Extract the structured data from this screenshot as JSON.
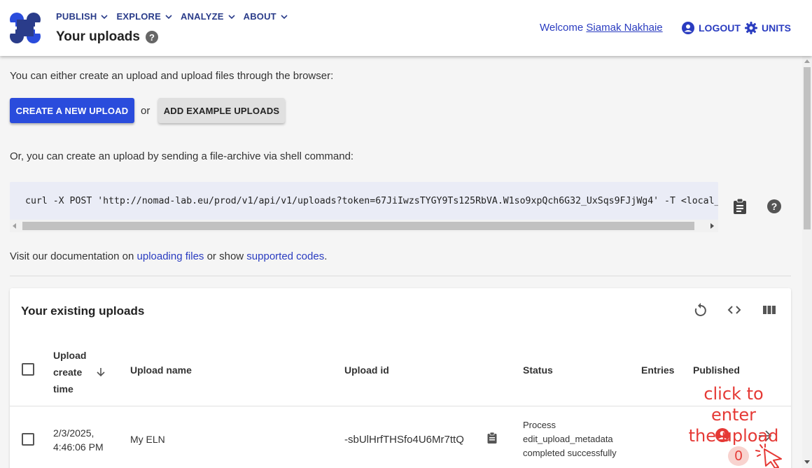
{
  "header": {
    "nav": [
      {
        "label": "PUBLISH"
      },
      {
        "label": "EXPLORE"
      },
      {
        "label": "ANALYZE"
      },
      {
        "label": "ABOUT"
      }
    ],
    "title": "Your uploads",
    "welcome_prefix": "Welcome",
    "user_name": "Siamak Nakhaie",
    "logout_label": "LOGOUT",
    "units_label": "UNITS"
  },
  "main": {
    "intro_text": "You can either create an upload and upload files through the browser:",
    "create_button": "CREATE A NEW UPLOAD",
    "or_text": "or",
    "example_button": "ADD EXAMPLE UPLOADS",
    "shell_text": "Or, you can create an upload by sending a file-archive via shell command:",
    "curl_command": "curl -X POST 'http://nomad-lab.eu/prod/v1/api/v1/uploads?token=67JiIwzsTYGY9Ts125RbVA.W1so9xpQch6G32_UxSqs9FJjWg4' -T <local_file>",
    "docs_prefix": "Visit our documentation on",
    "docs_link_1": "uploading files",
    "docs_middle": "or show",
    "docs_link_2": "supported codes",
    "docs_suffix": "."
  },
  "uploads": {
    "title": "Your existing uploads",
    "columns": {
      "create_time_1": "Upload",
      "create_time_2": "create",
      "create_time_3": "time",
      "name": "Upload name",
      "id": "Upload id",
      "status": "Status",
      "entries": "Entries",
      "published": "Published"
    },
    "rows": [
      {
        "date": "2/3/2025,",
        "time": "4:46:06 PM",
        "name": "My ELN",
        "id": "-sbUlHrfTHSfo4U6Mr7ttQ",
        "status_1": "Process",
        "status_2": "edit_upload_metadata",
        "status_3": "completed successfully",
        "entries": "0"
      }
    ]
  },
  "annotation": {
    "line_1": "click to enter",
    "line_2": "the upload"
  },
  "colors": {
    "primary": "#2a4cdc",
    "link": "#2a3cc0",
    "annotation": "#e53935"
  }
}
